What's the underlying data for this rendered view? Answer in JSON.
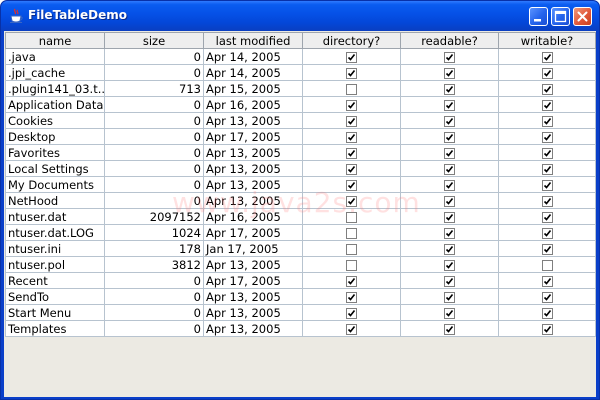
{
  "window": {
    "title": "FileTableDemo"
  },
  "table": {
    "columns": [
      "name",
      "size",
      "last modified",
      "directory?",
      "readable?",
      "writable?"
    ],
    "rows": [
      {
        "name": ".java",
        "size": "0",
        "modified": "Apr 14, 2005",
        "directory": true,
        "readable": true,
        "writable": true
      },
      {
        "name": ".jpi_cache",
        "size": "0",
        "modified": "Apr 14, 2005",
        "directory": true,
        "readable": true,
        "writable": true
      },
      {
        "name": ".plugin141_03.t...",
        "size": "713",
        "modified": "Apr 15, 2005",
        "directory": false,
        "readable": true,
        "writable": true
      },
      {
        "name": "Application Data",
        "size": "0",
        "modified": "Apr 16, 2005",
        "directory": true,
        "readable": true,
        "writable": true
      },
      {
        "name": "Cookies",
        "size": "0",
        "modified": "Apr 13, 2005",
        "directory": true,
        "readable": true,
        "writable": true
      },
      {
        "name": "Desktop",
        "size": "0",
        "modified": "Apr 17, 2005",
        "directory": true,
        "readable": true,
        "writable": true
      },
      {
        "name": "Favorites",
        "size": "0",
        "modified": "Apr 13, 2005",
        "directory": true,
        "readable": true,
        "writable": true
      },
      {
        "name": "Local Settings",
        "size": "0",
        "modified": "Apr 13, 2005",
        "directory": true,
        "readable": true,
        "writable": true
      },
      {
        "name": "My Documents",
        "size": "0",
        "modified": "Apr 13, 2005",
        "directory": true,
        "readable": true,
        "writable": true
      },
      {
        "name": "NetHood",
        "size": "0",
        "modified": "Apr 13, 2005",
        "directory": true,
        "readable": true,
        "writable": true
      },
      {
        "name": "ntuser.dat",
        "size": "2097152",
        "modified": "Apr 16, 2005",
        "directory": false,
        "readable": true,
        "writable": true
      },
      {
        "name": "ntuser.dat.LOG",
        "size": "1024",
        "modified": "Apr 17, 2005",
        "directory": false,
        "readable": true,
        "writable": true
      },
      {
        "name": "ntuser.ini",
        "size": "178",
        "modified": "Jan 17, 2005",
        "directory": false,
        "readable": true,
        "writable": true
      },
      {
        "name": "ntuser.pol",
        "size": "3812",
        "modified": "Apr 13, 2005",
        "directory": false,
        "readable": true,
        "writable": false
      },
      {
        "name": "Recent",
        "size": "0",
        "modified": "Apr 17, 2005",
        "directory": true,
        "readable": true,
        "writable": true
      },
      {
        "name": "SendTo",
        "size": "0",
        "modified": "Apr 13, 2005",
        "directory": true,
        "readable": true,
        "writable": true
      },
      {
        "name": "Start Menu",
        "size": "0",
        "modified": "Apr 13, 2005",
        "directory": true,
        "readable": true,
        "writable": true
      },
      {
        "name": "Templates",
        "size": "0",
        "modified": "Apr 13, 2005",
        "directory": true,
        "readable": true,
        "writable": true
      }
    ]
  },
  "watermark": "www.java2s.com",
  "icons": {
    "app": "java-coffee-cup-icon",
    "minimize": "minimize-icon",
    "maximize": "maximize-icon",
    "close": "close-icon",
    "check": "checkmark-icon"
  },
  "colors": {
    "titlebar": "#0550e6",
    "window_bg": "#eceae3",
    "grid": "#b7c3cf",
    "close_button": "#e1583a"
  }
}
